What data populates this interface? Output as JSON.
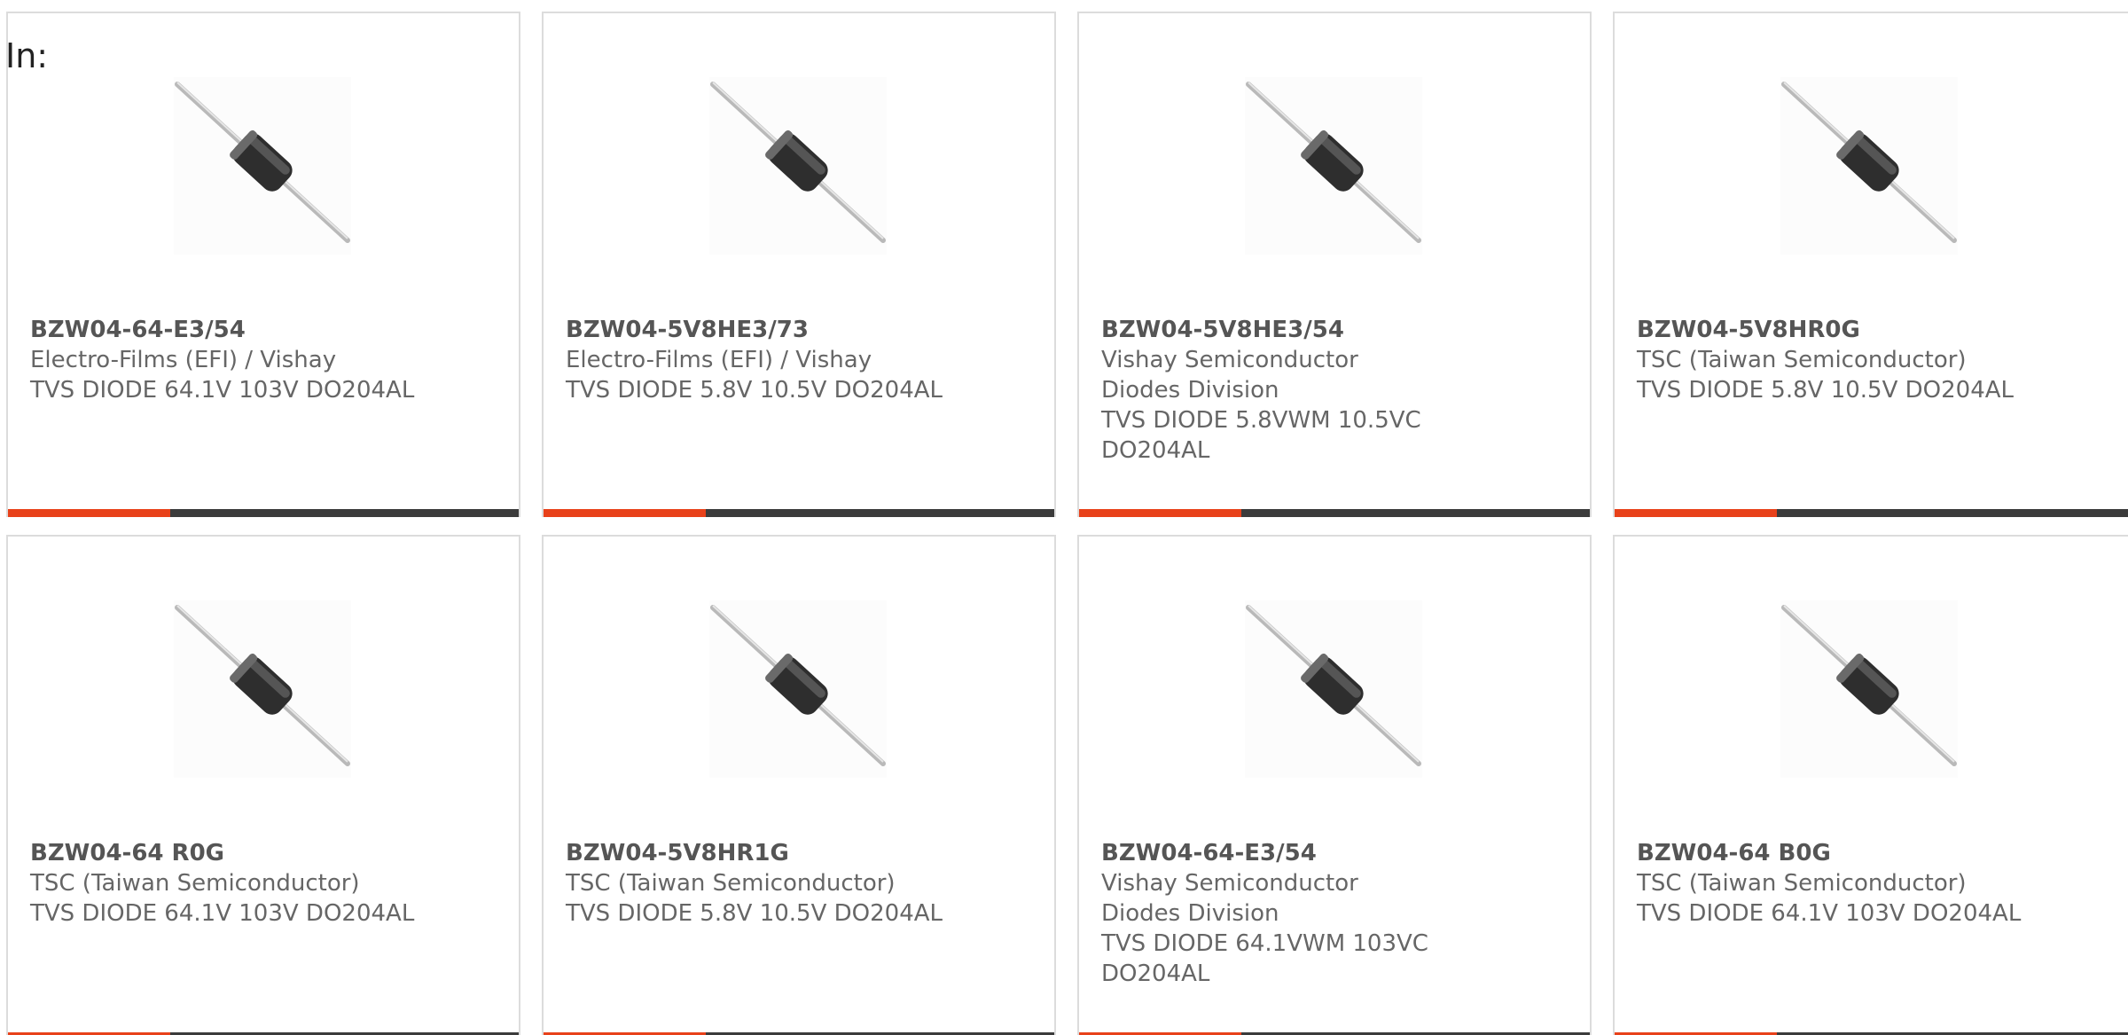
{
  "header": {
    "in_label": "In:"
  },
  "colors": {
    "accent": "#e8411a",
    "bar": "#3b3b3b",
    "border": "#dcdcdc",
    "text": "#666666"
  },
  "products": [
    {
      "part": "BZW04-64-E3/54",
      "manufacturer": "Electro-Films (EFI) / Vishay",
      "description": "TVS DIODE 64.1V 103V DO204AL",
      "image_icon": "axial-diode-icon"
    },
    {
      "part": "BZW04-5V8HE3/73",
      "manufacturer": "Electro-Films (EFI) / Vishay",
      "description": "TVS DIODE 5.8V 10.5V DO204AL",
      "image_icon": "axial-diode-icon"
    },
    {
      "part": "BZW04-5V8HE3/54",
      "manufacturer": "Vishay Semiconductor Diodes Division",
      "description": "TVS DIODE 5.8VWM 10.5VC DO204AL",
      "image_icon": "axial-diode-icon"
    },
    {
      "part": "BZW04-5V8HR0G",
      "manufacturer": "TSC (Taiwan Semiconductor)",
      "description": "TVS DIODE 5.8V 10.5V DO204AL",
      "image_icon": "axial-diode-icon"
    },
    {
      "part": "BZW04-64 R0G",
      "manufacturer": "TSC (Taiwan Semiconductor)",
      "description": "TVS DIODE 64.1V 103V DO204AL",
      "image_icon": "axial-diode-icon"
    },
    {
      "part": "BZW04-5V8HR1G",
      "manufacturer": "TSC (Taiwan Semiconductor)",
      "description": "TVS DIODE 5.8V 10.5V DO204AL",
      "image_icon": "axial-diode-icon"
    },
    {
      "part": "BZW04-64-E3/54",
      "manufacturer": "Vishay Semiconductor Diodes Division",
      "description": "TVS DIODE 64.1VWM 103VC DO204AL",
      "image_icon": "axial-diode-icon"
    },
    {
      "part": "BZW04-64 B0G",
      "manufacturer": "TSC (Taiwan Semiconductor)",
      "description": "TVS DIODE 64.1V 103V DO204AL",
      "image_icon": "axial-diode-icon"
    }
  ]
}
